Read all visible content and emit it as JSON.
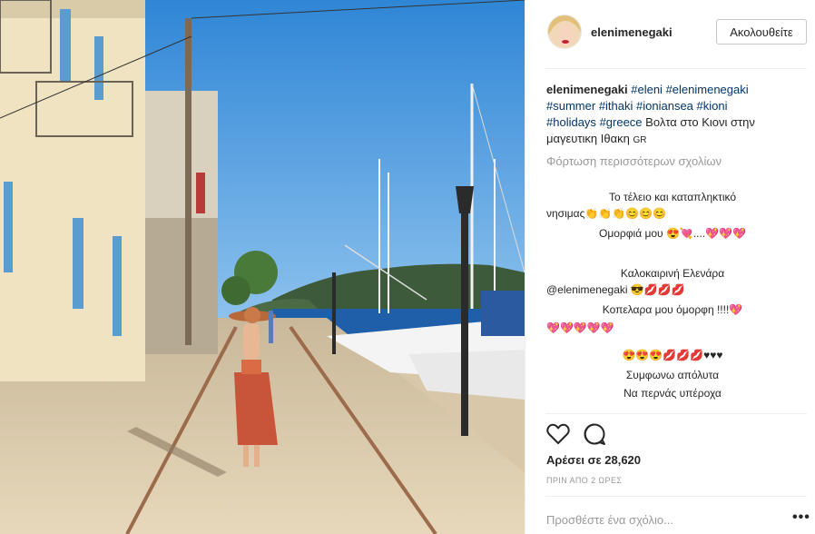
{
  "post": {
    "photo": {
      "icon": "photo-street-scene"
    },
    "author": {
      "username": "elenimenegaki",
      "avatar_icon": "avatar-icon"
    },
    "follow_label": "Ακολουθείτε",
    "caption": {
      "author": "elenimenegaki",
      "tags_line1": [
        "#eleni",
        "#elenimenegaki"
      ],
      "tags_line2": [
        "#summer",
        "#ithaki",
        "#ioniansea",
        "#kioni"
      ],
      "tags_line3": [
        "#holidays",
        "#greece"
      ],
      "text": "Βολτα στο Κιονι στην μαγευτικη Ιθακη",
      "flag": "GR"
    },
    "load_more": "Φόρτωση περισσότερων σχολίων",
    "comments": [
      {
        "text": "Το τέλειο και καταπληκτικό",
        "align": "center"
      },
      {
        "text": "νησιμας👏👏👏😊😊😊",
        "align": "left"
      },
      {
        "text": "Ομορφιά μου 😍💘....💖💖💖",
        "align": "center"
      },
      {
        "text": "",
        "align": "center"
      },
      {
        "text": "Καλοκαιρινή Ελενάρα",
        "align": "center"
      },
      {
        "text": "@elenimenegaki 😎💋💋💋",
        "align": "left"
      },
      {
        "text": "Κοπελαρα μου όμορφη !!!!💖",
        "align": "center"
      },
      {
        "text": "💖💖💖💖💖",
        "align": "left"
      },
      {
        "text": "",
        "align": "center"
      },
      {
        "text": "😍😍😍💋💋💋♥♥♥",
        "align": "center"
      },
      {
        "text": "Συμφωνω απόλυτα",
        "align": "center"
      },
      {
        "text": "Να περνάς υπέροχα",
        "align": "center"
      }
    ],
    "actions": {
      "like_icon": "heart-icon",
      "comment_icon": "comment-bubble-icon"
    },
    "likes": "Αρέσει σε 28,620",
    "timestamp": "ΠΡΙΝ ΑΠΟ 2 ΩΡΕΣ",
    "add_comment_placeholder": "Προσθέστε ένα σχόλιο...",
    "more_label": "•••",
    "colors": {
      "hashtag": "#003569",
      "muted": "#999999",
      "text": "#262626",
      "sky": "#3a8fd8",
      "sea": "#1f5ea8"
    }
  }
}
